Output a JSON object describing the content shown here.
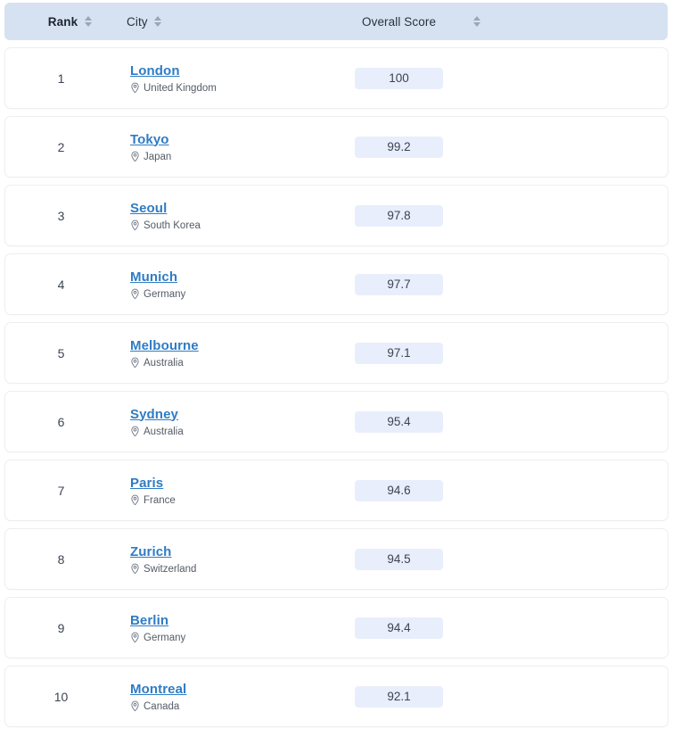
{
  "table": {
    "columns": [
      {
        "key": "rank",
        "label": "Rank",
        "sortable": true
      },
      {
        "key": "city",
        "label": "City",
        "sortable": true
      },
      {
        "key": "score",
        "label": "Overall Score",
        "sortable": true
      }
    ],
    "header_background": "#d6e2f2",
    "badge_background": "#e8eefb",
    "city_link_color": "#2e7cc4",
    "row_icon": "location-pin-icon",
    "sort_icon": "sort-updown-icon",
    "rows": [
      {
        "rank": "1",
        "city": "London",
        "country": "United Kingdom",
        "score": "100"
      },
      {
        "rank": "2",
        "city": "Tokyo",
        "country": "Japan",
        "score": "99.2"
      },
      {
        "rank": "3",
        "city": "Seoul",
        "country": "South Korea",
        "score": "97.8"
      },
      {
        "rank": "4",
        "city": "Munich",
        "country": "Germany",
        "score": "97.7"
      },
      {
        "rank": "5",
        "city": "Melbourne",
        "country": "Australia",
        "score": "97.1"
      },
      {
        "rank": "6",
        "city": "Sydney",
        "country": "Australia",
        "score": "95.4"
      },
      {
        "rank": "7",
        "city": "Paris",
        "country": "France",
        "score": "94.6"
      },
      {
        "rank": "8",
        "city": "Zurich",
        "country": "Switzerland",
        "score": "94.5"
      },
      {
        "rank": "9",
        "city": "Berlin",
        "country": "Germany",
        "score": "94.4"
      },
      {
        "rank": "10",
        "city": "Montreal",
        "country": "Canada",
        "score": "92.1"
      }
    ]
  }
}
